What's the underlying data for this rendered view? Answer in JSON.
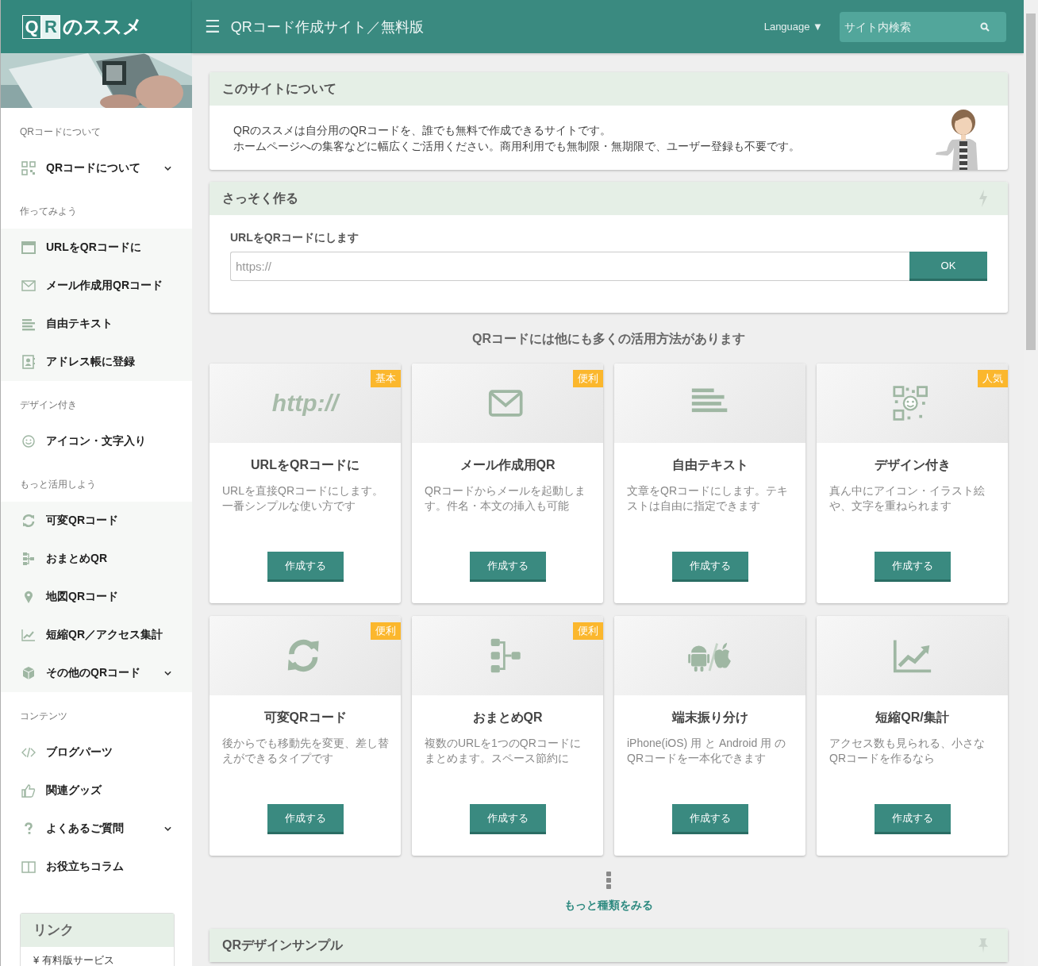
{
  "header": {
    "logo": {
      "letters": [
        "Q",
        "R"
      ],
      "text": "のススメ"
    },
    "menu_icon": "☰",
    "title": "QRコード作成サイト／無料版",
    "language": "Language ▼",
    "search": {
      "placeholder": "サイト内検索"
    }
  },
  "sidebar": {
    "sections": [
      {
        "heading": "QRコードについて",
        "shaded": false,
        "items": [
          {
            "label": "QRコードについて",
            "expandable": true
          }
        ]
      },
      {
        "heading": "作ってみよう",
        "shaded": true,
        "items": [
          {
            "label": "URLをQRコードに",
            "expandable": false
          },
          {
            "label": "メール作成用QRコード",
            "expandable": false
          },
          {
            "label": "自由テキスト",
            "expandable": false
          },
          {
            "label": "アドレス帳に登録",
            "expandable": false
          }
        ]
      },
      {
        "heading": "デザイン付き",
        "shaded": false,
        "items": [
          {
            "label": "アイコン・文字入り",
            "expandable": false
          }
        ]
      },
      {
        "heading": "もっと活用しよう",
        "shaded": true,
        "items": [
          {
            "label": "可変QRコード",
            "expandable": false
          },
          {
            "label": "おまとめQR",
            "expandable": false
          },
          {
            "label": "地図QRコード",
            "expandable": false
          },
          {
            "label": "短縮QR／アクセス集計",
            "expandable": false
          },
          {
            "label": "その他のQRコード",
            "expandable": true
          }
        ]
      },
      {
        "heading": "コンテンツ",
        "shaded": false,
        "items": [
          {
            "label": "ブログパーツ",
            "expandable": false
          },
          {
            "label": "関連グッズ",
            "expandable": false
          },
          {
            "label": "よくあるご質問",
            "expandable": true
          },
          {
            "label": "お役立ちコラム",
            "expandable": false
          }
        ]
      }
    ],
    "links": {
      "title": "リンク",
      "items": [
        "¥ 有料版サービス"
      ]
    }
  },
  "about": {
    "title": "このサイトについて",
    "lines": [
      "QRのススメは自分用のQRコードを、誰でも無料で作成できるサイトです。",
      "ホームページへの集客などに幅広くご活用ください。商用利用でも無制限・無期限で、ユーザー登録も不要です。"
    ]
  },
  "quick": {
    "title": "さっそく作る",
    "field_label": "URLをQRコードにします",
    "placeholder": "https://",
    "button": "OK"
  },
  "uses_heading": "QRコードには他にも多くの活用方法があります",
  "cards": [
    {
      "icon_text": "http://",
      "badge": "基本",
      "title": "URLをQRコードに",
      "description": "URLを直接QRコードにします。一番シンプルな使い方です",
      "button": "作成する"
    },
    {
      "badge": "便利",
      "title": "メール作成用QR",
      "description": "QRコードからメールを起動します。件名・本文の挿入も可能",
      "button": "作成する"
    },
    {
      "title": "自由テキスト",
      "description": "文章をQRコードにします。テキストは自由に指定できます",
      "button": "作成する"
    },
    {
      "badge": "人気",
      "title": "デザイン付き",
      "description": "真ん中にアイコン・イラスト絵や、文字を重ねられます",
      "button": "作成する"
    },
    {
      "badge": "便利",
      "title": "可変QRコード",
      "description": "後からでも移動先を変更、差し替えができるタイプです",
      "button": "作成する"
    },
    {
      "badge": "便利",
      "title": "おまとめQR",
      "description": "複数のURLを1つのQRコードにまとめます。スペース節約に",
      "button": "作成する"
    },
    {
      "title": "端末振り分け",
      "description": "iPhone(iOS) 用 と Android 用 のQRコードを一本化できます",
      "button": "作成する"
    },
    {
      "title": "短縮QR/集計",
      "description": "アクセス数も見られる、小さなQRコードを作るなら",
      "button": "作成する"
    }
  ],
  "more_link": "もっと種類をみる",
  "design_sample": {
    "title": "QRデザインサンプル"
  }
}
